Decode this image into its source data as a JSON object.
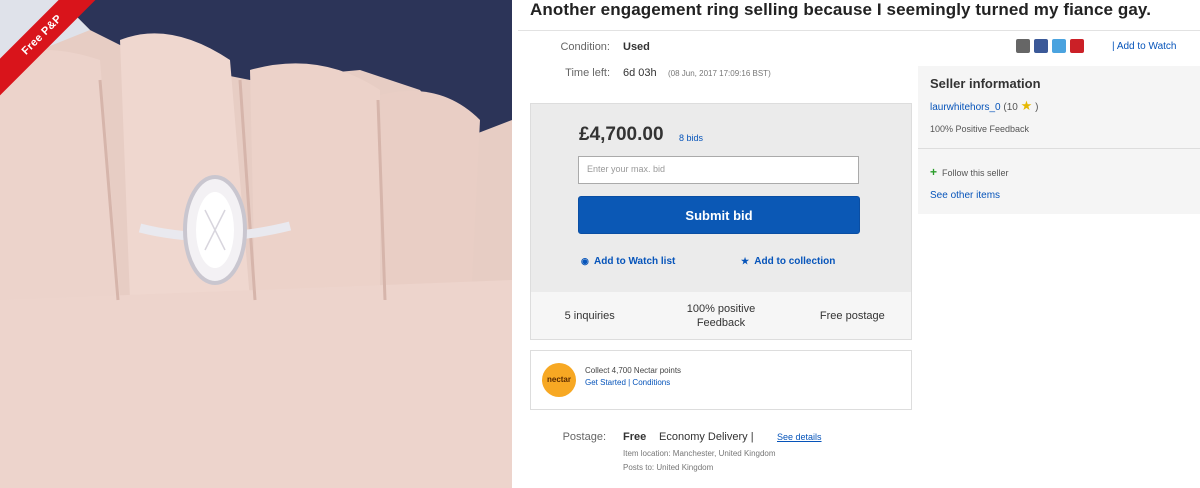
{
  "listing": {
    "title": "Another engagement ring selling because I seemingly turned my fiance gay.",
    "ribbon": "Free P&P",
    "condition_label": "Condition:",
    "condition_value": "Used",
    "time_left_label": "Time left:",
    "time_left_value": "6d 03h",
    "time_left_detail": "(08 Jun, 2017   17:09:16 BST)"
  },
  "share": {
    "add_to_watch": "| Add to Watch",
    "colors": [
      "#666666",
      "#3b5998",
      "#4aa3df",
      "#cb2027"
    ]
  },
  "bid": {
    "price": "£4,700.00",
    "bids": "8 bids",
    "placeholder": "Enter your max. bid",
    "submit_label": "Submit bid",
    "watch_link": "Add to Watch list",
    "collection_link": "Add to collection"
  },
  "stats": [
    "5 inquiries",
    "100% positive Feedback",
    "Free postage"
  ],
  "nectar": {
    "logo": "nectar",
    "line1": "Collect 4,700 Nectar points",
    "line2": "Get Started | Conditions"
  },
  "seller": {
    "heading": "Seller information",
    "name": "laurwhitehors_0",
    "score": "(10",
    "score_end": ")",
    "feedback": "100% Positive Feedback",
    "follow": "Follow this seller",
    "other_items": "See other items"
  },
  "postage": {
    "label": "Postage:",
    "free": "Free",
    "method": "Economy Delivery |",
    "details": "See details",
    "location": "Item location:  Manchester, United Kingdom",
    "posts_to": "Posts to:  United Kingdom"
  },
  "colors": {
    "accent": "#0654ba",
    "submit": "#0b58b5",
    "ribbon": "#d9141b"
  }
}
